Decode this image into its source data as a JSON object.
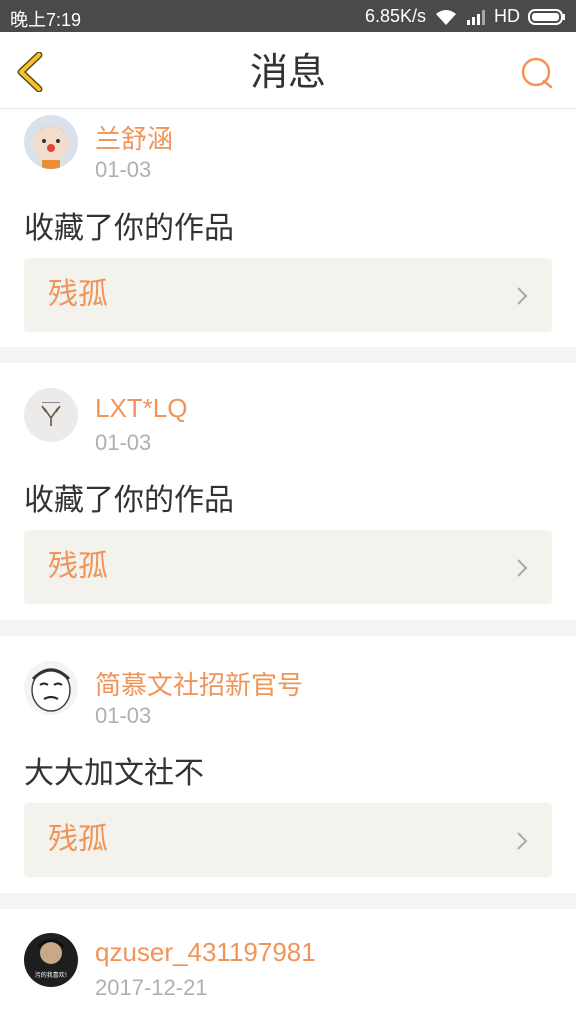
{
  "status_bar": {
    "time": "晚上7:19",
    "speed": "6.85K/s",
    "network": "HD"
  },
  "header": {
    "title": "消息",
    "back_icon": "chevron-left-icon",
    "search_icon": "search-icon"
  },
  "colors": {
    "accent": "#f0945a",
    "back_icon": "#f2c230",
    "work_box_bg": "#f3f2ec",
    "divider": "#f4f4f4"
  },
  "messages": [
    {
      "username": "兰舒涵",
      "date": "01-03",
      "text": "收藏了你的作品",
      "work_title": "残孤"
    },
    {
      "username": "LXT*LQ",
      "date": "01-03",
      "text": "收藏了你的作品",
      "work_title": "残孤"
    },
    {
      "username": "简慕文社招新官号",
      "date": "01-03",
      "text": "大大加文社不",
      "work_title": "残孤"
    },
    {
      "username": "qzuser_431197981",
      "date": "2017-12-21",
      "avatar_caption": "污的我喜欢!"
    }
  ]
}
